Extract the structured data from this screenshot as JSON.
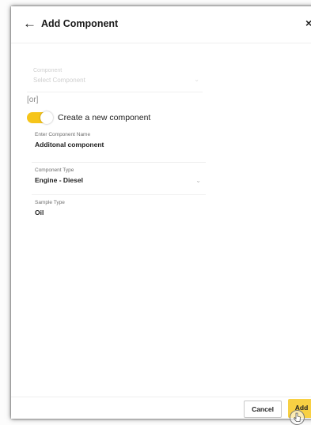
{
  "header": {
    "back_icon": "arrow-left-icon",
    "back_glyph": "←",
    "title": "Add Component",
    "close_icon": "close-icon",
    "close_glyph": "×"
  },
  "existing_component": {
    "label": "Component",
    "value": "Select Component",
    "state": "disabled"
  },
  "or_text": "[or]",
  "create_toggle": {
    "label": "Create a new component",
    "on": true,
    "color": "#f6c51a"
  },
  "component_name": {
    "label": "Enter Component Name",
    "value": "Additonal component"
  },
  "component_type": {
    "label": "Component Type",
    "value": "Engine - Diesel",
    "chevron_glyph": "⌄"
  },
  "sample_type": {
    "label": "Sample Type",
    "value": "Oil"
  },
  "footer": {
    "cancel_label": "Cancel",
    "add_label": "Add",
    "add_color": "#f8d043"
  }
}
